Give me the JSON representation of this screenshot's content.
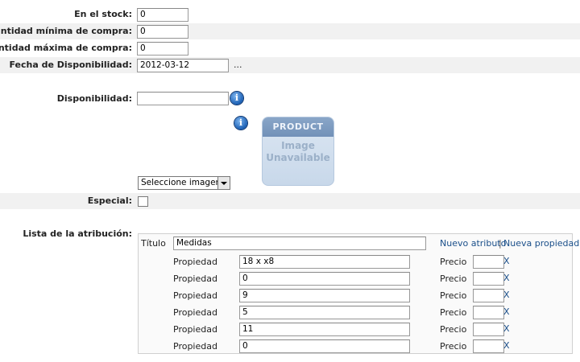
{
  "stock": {
    "label": "En el stock:",
    "value": "0"
  },
  "min_qty": {
    "label": "Cantidad mínima de compra:",
    "value": "0"
  },
  "max_qty": {
    "label": "Cantidad máxima de compra:",
    "value": "0"
  },
  "availability_date": {
    "label": "Fecha de Disponibilidad:",
    "value": "2012-03-12",
    "picker": "..."
  },
  "availability": {
    "label": "Disponibilidad:",
    "value": ""
  },
  "info_icon_glyph": "i",
  "product_image": {
    "header": "PRODUCT",
    "line1": "Image",
    "line2": "Unavailable"
  },
  "image_select": {
    "value": "Seleccione imagen"
  },
  "special": {
    "label": "Especial:",
    "checked": false
  },
  "attributes": {
    "label": "Lista de la atribución:",
    "title_label": "Título",
    "title_value": "Medidas",
    "new_attribute": "Nuevo atributo",
    "separator": "|",
    "new_property": "Nueva propiedad",
    "property_label": "Propiedad",
    "price_label": "Precio",
    "remove_label": "X",
    "rows": [
      {
        "property": "18 x x8",
        "price": ""
      },
      {
        "property": "0",
        "price": ""
      },
      {
        "property": "9",
        "price": ""
      },
      {
        "property": "5",
        "price": ""
      },
      {
        "property": "11",
        "price": ""
      },
      {
        "property": "0",
        "price": ""
      }
    ]
  }
}
